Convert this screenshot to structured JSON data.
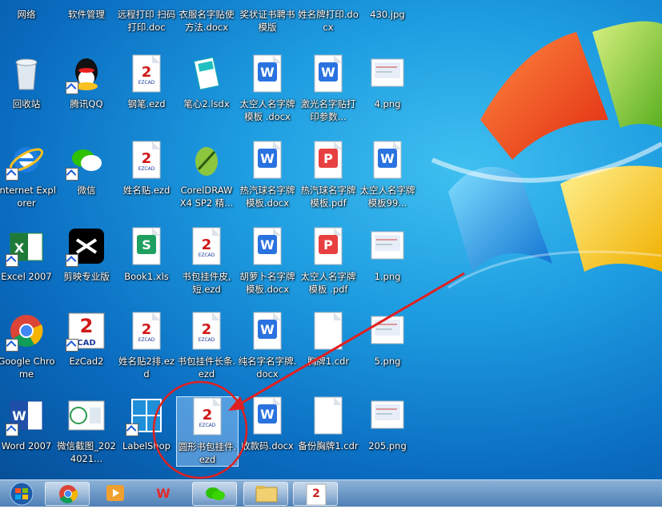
{
  "desktop": {
    "icons": [
      {
        "label": "网络"
      },
      {
        "label": "软件管理"
      },
      {
        "label": "远程打印 扫码打印.doc"
      },
      {
        "label": "衣服名字贴使方法.docx"
      },
      {
        "label": "奖状证书聘书模版"
      },
      {
        "label": "姓名牌打印.docx"
      },
      {
        "label": "430.jpg"
      },
      {
        "label": "回收站"
      },
      {
        "label": "腾讯QQ"
      },
      {
        "label": "钢笔.ezd"
      },
      {
        "label": "笔心2.lsdx"
      },
      {
        "label": "太空人名字牌模板 .docx"
      },
      {
        "label": "激光名字贴打印参数..."
      },
      {
        "label": "4.png"
      },
      {
        "label": "Internet Explorer"
      },
      {
        "label": "微信"
      },
      {
        "label": "姓名贴.ezd"
      },
      {
        "label": "CorelDRAW X4 SP2 精..."
      },
      {
        "label": "热汽球名字牌模板.docx"
      },
      {
        "label": "热汽球名字牌模板.pdf"
      },
      {
        "label": "太空人名字牌模板99..."
      },
      {
        "label": "Excel 2007"
      },
      {
        "label": "剪映专业版"
      },
      {
        "label": "Book1.xls"
      },
      {
        "label": "书包挂件皮,短.ezd"
      },
      {
        "label": "胡萝卜名字牌模板.docx"
      },
      {
        "label": "太空人名字牌模板 .pdf"
      },
      {
        "label": "1.png"
      },
      {
        "label": "Google Chrome"
      },
      {
        "label": "EzCad2"
      },
      {
        "label": "姓名贴2排.ezd"
      },
      {
        "label": "书包挂件长条.ezd"
      },
      {
        "label": "纯名字名字牌.docx"
      },
      {
        "label": "胸牌1.cdr"
      },
      {
        "label": "5.png"
      },
      {
        "label": "Word 2007"
      },
      {
        "label": "微信截图_2024021..."
      },
      {
        "label": "LabelShop"
      },
      {
        "label": "圆形书包挂件.ezd"
      },
      {
        "label": "收款码.docx"
      },
      {
        "label": "备份胸牌1.cdr"
      },
      {
        "label": "205.png"
      }
    ]
  },
  "annotation": {
    "color": "#e02020"
  },
  "taskbar": {
    "items": [
      {
        "icon": "windows-start-icon"
      },
      {
        "icon": "chrome-icon"
      },
      {
        "icon": "video-player-icon"
      },
      {
        "icon": "wps-icon"
      },
      {
        "icon": "wechat-icon"
      },
      {
        "icon": "file-explorer-icon"
      },
      {
        "icon": "ezcad-icon"
      }
    ]
  },
  "colors": {
    "accent": "#1d9be0",
    "taskbar": "#6f9cc8"
  }
}
